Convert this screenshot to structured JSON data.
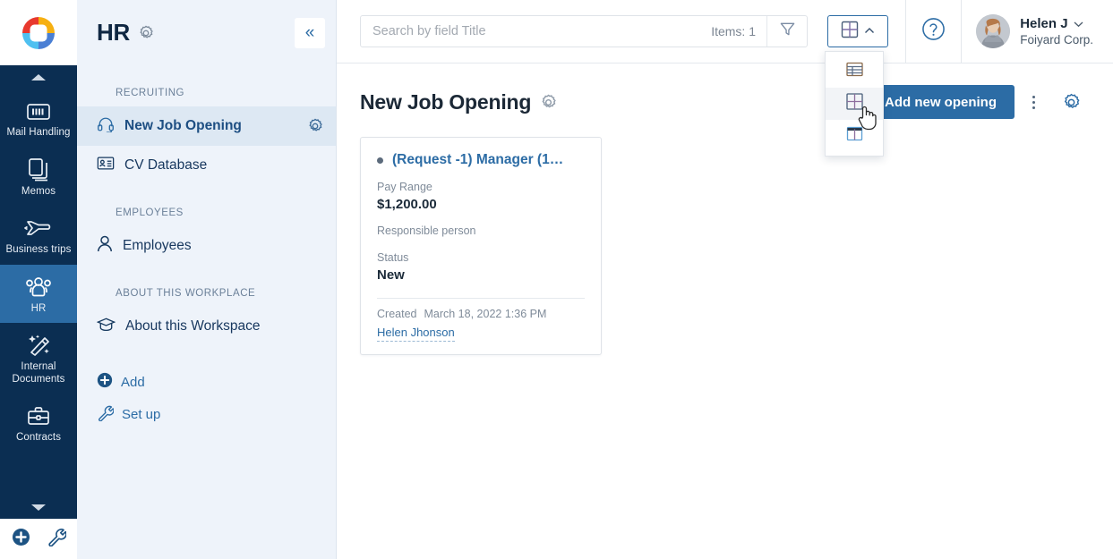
{
  "brand": {
    "logo_icon": "bitrix-logo-icon",
    "colors": {
      "red": "#e8392e",
      "yellow": "#f6b012",
      "blue": "#4a7fd4",
      "light_blue": "#4fc0f0",
      "accent": "#2c6ca5",
      "rail_bg": "#0b2e52"
    }
  },
  "rail": {
    "scroll_up_icon": "caret-up-icon",
    "scroll_down_icon": "caret-down-icon",
    "items": [
      {
        "label": "Mail Handling",
        "icon": "barcode-icon",
        "active": false
      },
      {
        "label": "Memos",
        "icon": "documents-copy-icon",
        "active": false
      },
      {
        "label": "Business trips",
        "icon": "airplane-icon",
        "active": false
      },
      {
        "label": "HR",
        "icon": "people-group-icon",
        "active": true
      },
      {
        "label": "Internal Documents",
        "icon": "magic-wand-icon",
        "active": false
      },
      {
        "label": "Contracts",
        "icon": "briefcase-icon",
        "active": false
      }
    ],
    "bottom": [
      {
        "icon": "plus-circle-icon",
        "name": "add-button"
      },
      {
        "icon": "wrench-icon",
        "name": "settings-wrench-button"
      }
    ]
  },
  "sidebar": {
    "title": "HR",
    "title_gear_icon": "gear-icon",
    "collapse_icon": "«",
    "sections": [
      {
        "label": "RECRUITING",
        "caret_icon": "caret-down-icon",
        "items": [
          {
            "label": "New Job Opening",
            "icon": "headset-icon",
            "active": true,
            "gear_icon": "gear-icon"
          },
          {
            "label": "CV Database",
            "icon": "id-card-icon",
            "active": false
          }
        ]
      },
      {
        "label": "EMPLOYEES",
        "caret_icon": "caret-down-icon",
        "items": [
          {
            "label": "Employees",
            "icon": "person-icon",
            "active": false
          }
        ]
      },
      {
        "label": "ABOUT THIS WORKPLACE",
        "caret_icon": "caret-down-icon",
        "items": [
          {
            "label": "About this Workspace",
            "icon": "graduation-cap-icon",
            "active": false
          }
        ]
      }
    ],
    "actions": [
      {
        "label": "Add",
        "icon": "plus-circle-icon"
      },
      {
        "label": "Set up",
        "icon": "wrench-icon"
      }
    ]
  },
  "topbar": {
    "search": {
      "value": "",
      "placeholder": "Search by field Title"
    },
    "items_count": "Items: 1",
    "filter_icon": "funnel-icon",
    "view_button": {
      "icon": "grid-view-icon",
      "chevron": "chevron-up-icon"
    },
    "help_icon": "question-circle-icon",
    "user": {
      "name": "Helen J",
      "org": "Foiyard Corp.",
      "chevron": "chevron-down-icon",
      "avatar_icon": "user-avatar-photo"
    }
  },
  "view_menu": {
    "options": [
      {
        "icon": "list-view-icon",
        "name": "view-option-list",
        "selected": false
      },
      {
        "icon": "grid-view-icon",
        "name": "view-option-grid",
        "selected": true
      },
      {
        "icon": "column-view-icon",
        "name": "view-option-columns",
        "selected": false
      }
    ]
  },
  "page": {
    "title": "New Job Opening",
    "title_gear_icon": "gear-icon",
    "primary_button": "Add new opening",
    "kebab_icon": "more-vertical-icon",
    "settings_icon": "gear-icon"
  },
  "card": {
    "status_dot_color": "#5c6b7c",
    "title": "(Request -1) Manager (1…",
    "fields": [
      {
        "label": "Pay Range",
        "value": "$1,200.00"
      },
      {
        "label": "Responsible person",
        "value": ""
      },
      {
        "label": "Status",
        "value": "New"
      }
    ],
    "created_label": "Created",
    "created_date": "March 18, 2022 1:36 PM",
    "created_by": "Helen Jhonson"
  }
}
